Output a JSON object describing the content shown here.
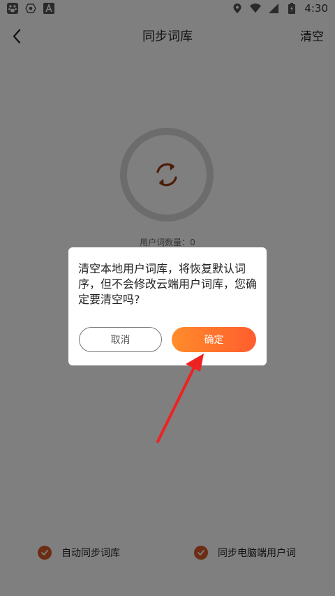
{
  "status_bar": {
    "time": "4:30",
    "left_icons": [
      "baidu-paw-icon",
      "camera-icon",
      "text-a-icon"
    ],
    "right_icons": [
      "location-icon",
      "wifi-icon",
      "signal-icon",
      "battery-icon"
    ]
  },
  "header": {
    "back_icon": "chevron-left-icon",
    "title": "同步词库",
    "action_label": "清空"
  },
  "sync": {
    "icon": "refresh-icon",
    "word_count_label": "用户词数量：0"
  },
  "options": [
    {
      "label": "自动同步词库",
      "checked": true
    },
    {
      "label": "同步电脑端用户词",
      "checked": true
    }
  ],
  "dialog": {
    "message": "清空本地用户词库，将恢复默认词序，但不会修改云端用户词库，您确定要清空吗?",
    "cancel_label": "取消",
    "confirm_label": "确定"
  },
  "colors": {
    "accent": "#ff6a2c",
    "check": "#d95a2b",
    "sync_icon": "#9a3a14",
    "overlay": "#000000",
    "annotation_arrow": "#ee2222"
  }
}
